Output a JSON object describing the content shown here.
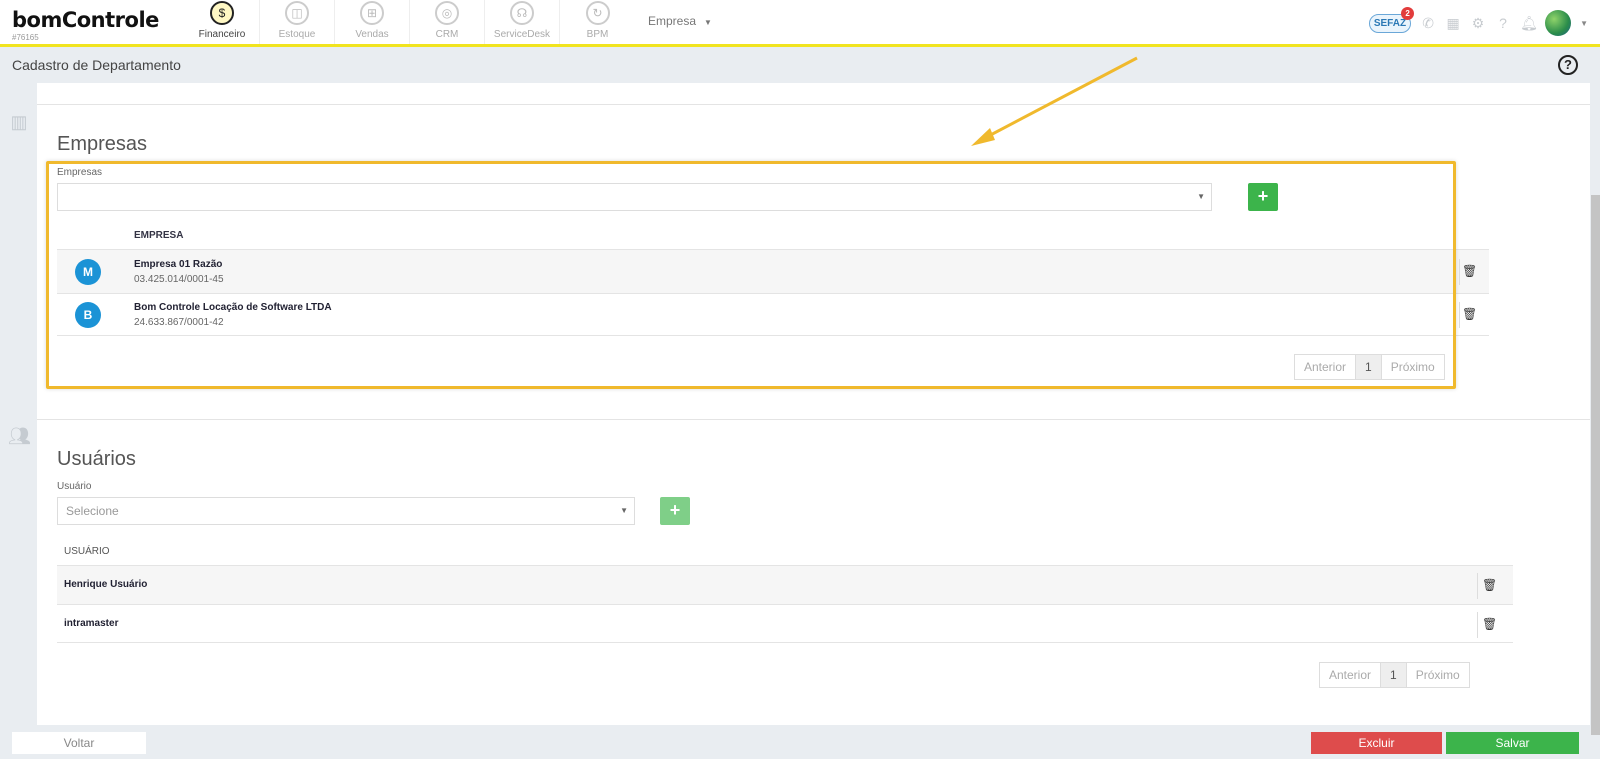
{
  "header": {
    "logo": "bomControle",
    "account_code": "#76165",
    "nav": [
      {
        "label": "Financeiro",
        "icon": "dollar-icon",
        "glyph": "$",
        "active": true
      },
      {
        "label": "Estoque",
        "icon": "box-icon",
        "glyph": "◫",
        "active": false
      },
      {
        "label": "Vendas",
        "icon": "cart-icon",
        "glyph": "⊞",
        "active": false
      },
      {
        "label": "CRM",
        "icon": "target-icon",
        "glyph": "◎",
        "active": false
      },
      {
        "label": "ServiceDesk",
        "icon": "headset-icon",
        "glyph": "☊",
        "active": false
      },
      {
        "label": "BPM",
        "icon": "cycle-icon",
        "glyph": "↻",
        "active": false
      }
    ],
    "company_menu": "Empresa",
    "sefaz_label": "SEFAZ",
    "sefaz_badge": "2"
  },
  "page": {
    "title": "Cadastro de Departamento"
  },
  "empresas": {
    "section_title": "Empresas",
    "field_label": "Empresas",
    "select_value": "",
    "add_label": "+",
    "column_header": "EMPRESA",
    "rows": [
      {
        "initial": "M",
        "name": "Empresa 01 Razão",
        "cnpj": "03.425.014/0001-45"
      },
      {
        "initial": "B",
        "name": "Bom Controle Locação de Software LTDA",
        "cnpj": "24.633.867/0001-42"
      }
    ],
    "pager": {
      "prev": "Anterior",
      "page": "1",
      "next": "Próximo"
    }
  },
  "usuarios": {
    "section_title": "Usuários",
    "field_label": "Usuário",
    "select_placeholder": "Selecione",
    "add_label": "+",
    "column_header": "USUÁRIO",
    "rows": [
      {
        "name": "Henrique Usuário"
      },
      {
        "name": "intramaster"
      }
    ],
    "pager": {
      "prev": "Anterior",
      "page": "1",
      "next": "Próximo"
    }
  },
  "footer": {
    "back": "Voltar",
    "delete": "Excluir",
    "save": "Salvar"
  },
  "colors": {
    "accent_yellow": "#f1e41f",
    "highlight": "#f0b92d",
    "success": "#3cb44b",
    "danger": "#de4c4c",
    "avatar_circle": "#1b93d6"
  }
}
